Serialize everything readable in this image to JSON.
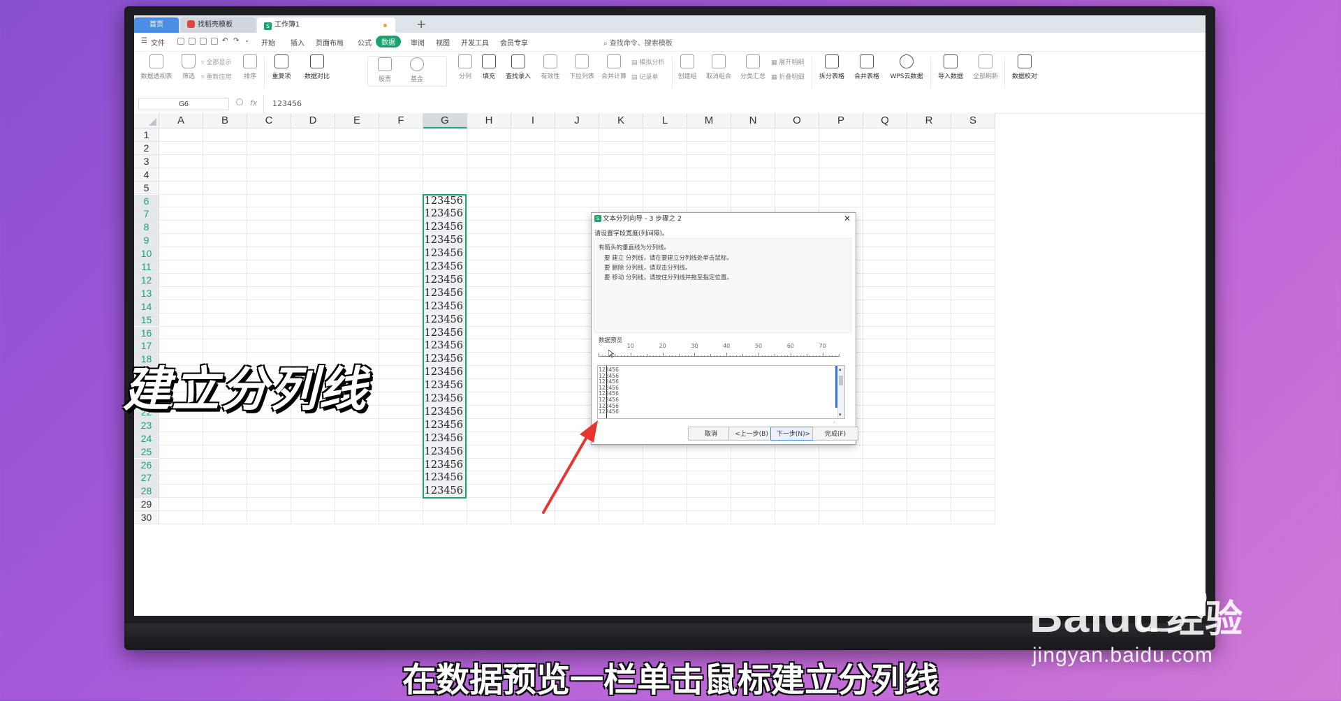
{
  "tabs": {
    "home": "首页",
    "template": "找稻壳模板",
    "workbook": "工作簿1",
    "add": "+"
  },
  "menu": {
    "file": "文件",
    "items": [
      "开始",
      "插入",
      "页面布局",
      "公式",
      "数据",
      "审阅",
      "视图",
      "开发工具",
      "会员专享"
    ],
    "active": "数据",
    "search": "查找命令、搜索模板"
  },
  "ribbon": {
    "pivot": "数据透视表",
    "filter": "筛选",
    "show_all": "全部显示",
    "reapply": "重新应用",
    "sort": "排序",
    "duplicates": "重复项",
    "compare": "数据对比",
    "stock": "股票",
    "fund": "基金",
    "split": "分列",
    "fill": "填充",
    "lookup": "查找录入",
    "validity": "有效性",
    "dropdown": "下拉列表",
    "consolidate": "合并计算",
    "simulate": "模拟分析",
    "record": "记录单",
    "group": "创建组",
    "ungroup": "取消组合",
    "subtotal": "分类汇总",
    "expand": "展开明细",
    "collapse": "折叠明细",
    "split_table": "拆分表格",
    "merge_table": "合并表格",
    "cloud": "WPS云数据",
    "import": "导入数据",
    "refresh": "全部刷新",
    "verify": "数据校对"
  },
  "formula_bar": {
    "name_box": "G6",
    "fx": "fx",
    "value": "123456"
  },
  "columns": [
    "A",
    "B",
    "C",
    "D",
    "E",
    "F",
    "G",
    "H",
    "I",
    "J",
    "K",
    "L",
    "M",
    "N",
    "O",
    "P",
    "Q",
    "R",
    "S"
  ],
  "rows": [
    "1",
    "2",
    "3",
    "4",
    "5",
    "6",
    "7",
    "8",
    "9",
    "10",
    "11",
    "12",
    "13",
    "14",
    "15",
    "16",
    "17",
    "18",
    "19",
    "20",
    "21",
    "22",
    "23",
    "24",
    "25",
    "26",
    "27",
    "28",
    "29",
    "30"
  ],
  "selected_column": "G",
  "cell_value": "123456",
  "dialog": {
    "title": "文本分列向导 - 3 步骤之 2",
    "subtitle": "请设置字段宽度(列间隔)。",
    "info": [
      "有箭头的垂直线为分列线。",
      "要 建立 分列线，请在要建立分列线处单击鼠标。",
      "要 删除 分列线，请双击分列线。",
      "要 移动 分列线，请按住分列线并拖至指定位置。"
    ],
    "preview_label": "数据预览",
    "ruler_numbers": [
      "10",
      "20",
      "30",
      "40",
      "50",
      "60",
      "70"
    ],
    "preview_lines": [
      "123456",
      "123456",
      "123456",
      "123456",
      "123456",
      "123456",
      "123456",
      "123456"
    ],
    "buttons": {
      "cancel": "取消",
      "back": "<上一步(B)",
      "next": "下一步(N)>",
      "finish": "完成(F)"
    }
  },
  "overlay": {
    "caption": "建立分列线",
    "subtitle": "在数据预览一栏单击鼠标建立分列线",
    "watermark_logo": "Baidu",
    "watermark_cn": "经验",
    "watermark_url": "jingyan.baidu.com"
  },
  "colors": {
    "accent": "#1aa36c",
    "arrow": "#e5372f"
  }
}
